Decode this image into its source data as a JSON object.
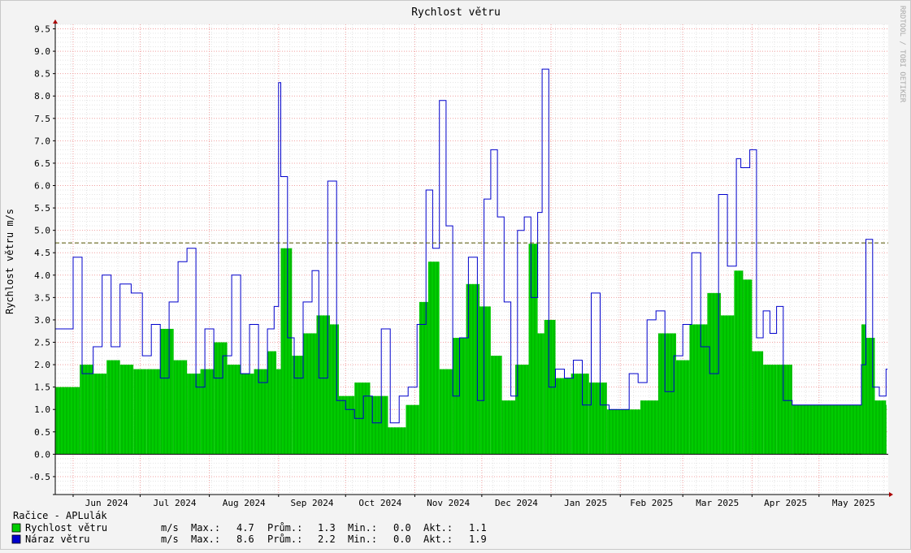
{
  "chart_data": {
    "type": "area",
    "title": "Rychlost větru",
    "ylabel": "Rychlost větru m/s",
    "watermark": "RRDTOOL / TOBI OETIKER",
    "ylim": [
      -0.9,
      9.6
    ],
    "yticks": [
      -0.5,
      0.0,
      0.5,
      1.0,
      1.5,
      2.0,
      2.5,
      3.0,
      3.5,
      4.0,
      4.5,
      5.0,
      5.5,
      6.0,
      6.5,
      7.0,
      7.5,
      8.0,
      8.5,
      9.0,
      9.5
    ],
    "xlim": [
      "2024-05-24",
      "2025-06-01"
    ],
    "xlabels": [
      {
        "date": "2024-06-01",
        "label": "Jun 2024"
      },
      {
        "date": "2024-07-01",
        "label": "Jul 2024"
      },
      {
        "date": "2024-08-01",
        "label": "Aug 2024"
      },
      {
        "date": "2024-09-01",
        "label": "Sep 2024"
      },
      {
        "date": "2024-10-01",
        "label": "Oct 2024"
      },
      {
        "date": "2024-11-01",
        "label": "Nov 2024"
      },
      {
        "date": "2024-12-01",
        "label": "Dec 2024"
      },
      {
        "date": "2025-01-01",
        "label": "Jan 2025"
      },
      {
        "date": "2025-02-01",
        "label": "Feb 2025"
      },
      {
        "date": "2025-03-01",
        "label": "Mar 2025"
      },
      {
        "date": "2025-04-01",
        "label": "Apr 2025"
      },
      {
        "date": "2025-05-01",
        "label": "May 2025"
      }
    ],
    "hline": {
      "value": 4.72
    },
    "gaps": [
      [
        "2025-04-20",
        "2025-05-20"
      ]
    ],
    "series": [
      {
        "name": "Rychlost větru",
        "color": "#00cc00",
        "x": [
          "2024-05-24",
          "2024-06-04",
          "2024-06-10",
          "2024-06-16",
          "2024-06-22",
          "2024-06-28",
          "2024-07-04",
          "2024-07-10",
          "2024-07-16",
          "2024-07-22",
          "2024-07-28",
          "2024-08-03",
          "2024-08-09",
          "2024-08-15",
          "2024-08-21",
          "2024-08-27",
          "2024-08-31",
          "2024-09-02",
          "2024-09-07",
          "2024-09-12",
          "2024-09-18",
          "2024-09-24",
          "2024-09-28",
          "2024-10-05",
          "2024-10-12",
          "2024-10-20",
          "2024-10-28",
          "2024-11-03",
          "2024-11-07",
          "2024-11-12",
          "2024-11-18",
          "2024-11-24",
          "2024-11-30",
          "2024-12-05",
          "2024-12-10",
          "2024-12-16",
          "2024-12-22",
          "2024-12-26",
          "2024-12-29",
          "2025-01-03",
          "2025-01-10",
          "2025-01-18",
          "2025-01-26",
          "2025-02-02",
          "2025-02-10",
          "2025-02-18",
          "2025-02-26",
          "2025-03-04",
          "2025-03-12",
          "2025-03-18",
          "2025-03-24",
          "2025-03-28",
          "2025-04-01",
          "2025-04-06",
          "2025-04-12",
          "2025-04-19",
          "2025-05-20",
          "2025-05-22",
          "2025-05-26",
          "2025-05-31"
        ],
        "values": [
          1.5,
          2.0,
          1.8,
          2.1,
          2.0,
          1.9,
          1.9,
          2.8,
          2.1,
          1.8,
          1.9,
          2.5,
          2.0,
          1.8,
          1.9,
          2.3,
          1.9,
          4.6,
          2.2,
          2.7,
          3.1,
          2.9,
          1.3,
          1.6,
          1.3,
          0.6,
          1.1,
          3.4,
          4.3,
          1.9,
          2.6,
          3.8,
          3.3,
          2.2,
          1.2,
          2.0,
          4.7,
          2.7,
          3.0,
          1.7,
          1.8,
          1.6,
          1.0,
          1.0,
          1.2,
          2.7,
          2.1,
          2.9,
          3.6,
          3.1,
          4.1,
          3.9,
          2.3,
          2.0,
          2.0,
          1.1,
          2.9,
          2.6,
          1.2,
          1.1
        ]
      },
      {
        "name": "Náraz větru",
        "color": "#0000cc",
        "x": [
          "2024-05-24",
          "2024-06-01",
          "2024-06-05",
          "2024-06-10",
          "2024-06-14",
          "2024-06-18",
          "2024-06-22",
          "2024-06-27",
          "2024-07-02",
          "2024-07-06",
          "2024-07-10",
          "2024-07-14",
          "2024-07-18",
          "2024-07-22",
          "2024-07-26",
          "2024-07-30",
          "2024-08-03",
          "2024-08-07",
          "2024-08-11",
          "2024-08-15",
          "2024-08-19",
          "2024-08-23",
          "2024-08-27",
          "2024-08-30",
          "2024-09-01",
          "2024-09-02",
          "2024-09-05",
          "2024-09-08",
          "2024-09-12",
          "2024-09-16",
          "2024-09-19",
          "2024-09-23",
          "2024-09-27",
          "2024-10-01",
          "2024-10-05",
          "2024-10-09",
          "2024-10-13",
          "2024-10-17",
          "2024-10-21",
          "2024-10-25",
          "2024-10-29",
          "2024-11-02",
          "2024-11-06",
          "2024-11-09",
          "2024-11-12",
          "2024-11-15",
          "2024-11-18",
          "2024-11-21",
          "2024-11-25",
          "2024-11-29",
          "2024-12-02",
          "2024-12-05",
          "2024-12-08",
          "2024-12-11",
          "2024-12-14",
          "2024-12-17",
          "2024-12-20",
          "2024-12-23",
          "2024-12-26",
          "2024-12-28",
          "2024-12-31",
          "2025-01-03",
          "2025-01-07",
          "2025-01-11",
          "2025-01-15",
          "2025-01-19",
          "2025-01-23",
          "2025-01-27",
          "2025-02-01",
          "2025-02-05",
          "2025-02-09",
          "2025-02-13",
          "2025-02-17",
          "2025-02-21",
          "2025-02-25",
          "2025-03-01",
          "2025-03-05",
          "2025-03-09",
          "2025-03-13",
          "2025-03-17",
          "2025-03-21",
          "2025-03-25",
          "2025-03-27",
          "2025-03-31",
          "2025-04-03",
          "2025-04-06",
          "2025-04-09",
          "2025-04-12",
          "2025-04-15",
          "2025-04-19",
          "2025-05-20",
          "2025-05-22",
          "2025-05-25",
          "2025-05-28",
          "2025-05-31"
        ],
        "values": [
          2.8,
          4.4,
          1.8,
          2.4,
          4.0,
          2.4,
          3.8,
          3.6,
          2.2,
          2.9,
          1.7,
          3.4,
          4.3,
          4.6,
          1.5,
          2.8,
          1.7,
          2.2,
          4.0,
          1.8,
          2.9,
          1.6,
          2.8,
          3.3,
          8.3,
          6.2,
          2.6,
          1.7,
          3.4,
          4.1,
          1.7,
          6.1,
          1.2,
          1.0,
          0.8,
          1.3,
          0.7,
          2.8,
          0.7,
          1.3,
          1.5,
          2.9,
          5.9,
          4.6,
          7.9,
          5.1,
          1.3,
          2.6,
          4.4,
          1.2,
          5.7,
          6.8,
          5.3,
          3.4,
          1.3,
          5.0,
          5.3,
          3.5,
          5.4,
          8.6,
          1.5,
          1.9,
          1.7,
          2.1,
          1.1,
          3.6,
          1.1,
          1.0,
          1.0,
          1.8,
          1.6,
          3.0,
          3.2,
          1.4,
          2.2,
          2.9,
          4.5,
          2.4,
          1.8,
          5.8,
          4.2,
          6.6,
          6.4,
          6.8,
          2.6,
          3.2,
          2.7,
          3.3,
          1.2,
          1.1,
          2.0,
          4.8,
          1.5,
          1.3,
          1.9
        ]
      }
    ]
  },
  "legend": {
    "location": "Račice - APLulák",
    "rows": [
      {
        "name": "Rychlost větru",
        "color": "#00cc00",
        "unit": "m/s",
        "max_label": "Max.:",
        "max": "4.7",
        "avg_label": "Prům.:",
        "avg": "1.3",
        "min_label": "Min.:",
        "min": "0.0",
        "cur_label": "Akt.:",
        "cur": "1.1"
      },
      {
        "name": "Náraz větru",
        "color": "#0000cc",
        "unit": "m/s",
        "max_label": "Max.:",
        "max": "8.6",
        "avg_label": "Prům.:",
        "avg": "2.2",
        "min_label": "Min.:",
        "min": "0.0",
        "cur_label": "Akt.:",
        "cur": "1.9"
      }
    ]
  }
}
